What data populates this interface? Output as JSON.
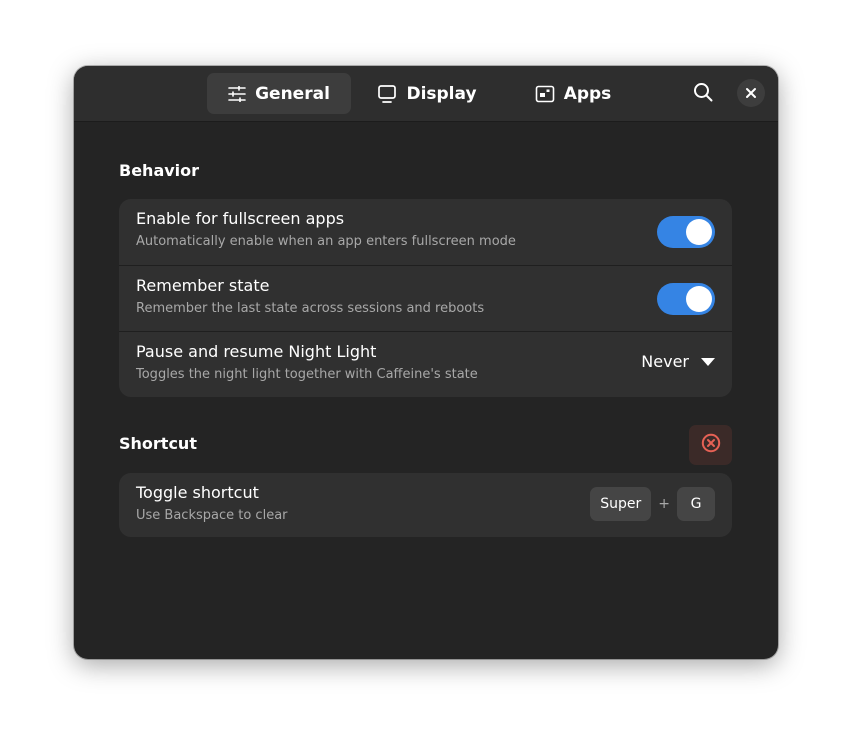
{
  "header": {
    "tabs": [
      {
        "label": "General",
        "icon": "sliders-icon",
        "active": true
      },
      {
        "label": "Display",
        "icon": "monitor-icon",
        "active": false
      },
      {
        "label": "Apps",
        "icon": "apps-window-icon",
        "active": false
      }
    ],
    "search_icon": "search-icon",
    "close_icon": "close-icon"
  },
  "behavior": {
    "title": "Behavior",
    "rows": [
      {
        "title": "Enable for fullscreen apps",
        "subtitle": "Automatically enable when an app enters fullscreen mode",
        "enabled": true
      },
      {
        "title": "Remember state",
        "subtitle": "Remember the last state across sessions and reboots",
        "enabled": true
      },
      {
        "title": "Pause and resume Night Light",
        "subtitle": "Toggles the night light together with Caffeine's state",
        "value": "Never"
      }
    ]
  },
  "shortcut": {
    "title": "Shortcut",
    "clear_icon": "clear-circle-icon",
    "row": {
      "title": "Toggle shortcut",
      "subtitle": "Use Backspace to clear",
      "keys": [
        "Super",
        "G"
      ],
      "separator": "+"
    }
  },
  "colors": {
    "accent": "#3584e4",
    "destructive": "#e66155",
    "window_bg": "#242424",
    "card_bg": "#303030"
  }
}
